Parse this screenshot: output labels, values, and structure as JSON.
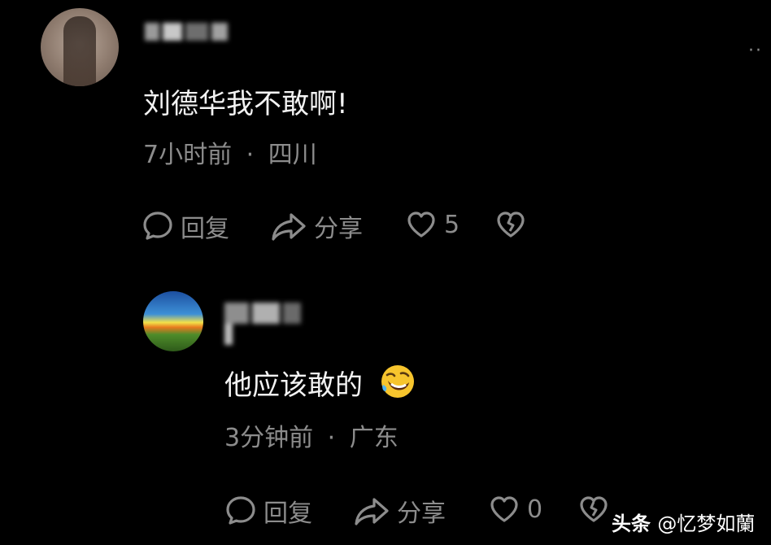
{
  "comment1": {
    "author_name": "",
    "text": "刘德华我不敢啊!",
    "time": "7小时前",
    "location": "四川",
    "reply_label": "回复",
    "share_label": "分享",
    "like_count": "5",
    "more_icon": "more-icon"
  },
  "comment2": {
    "author_name": "",
    "text": "他应该敢的",
    "emoji": "rolling-on-floor-laughing",
    "time": "3分钟前",
    "location": "广东",
    "reply_label": "回复",
    "share_label": "分享",
    "like_count": "0"
  },
  "separator": "·",
  "watermark": {
    "brand": "头条",
    "handle": "@忆梦如蘭"
  }
}
